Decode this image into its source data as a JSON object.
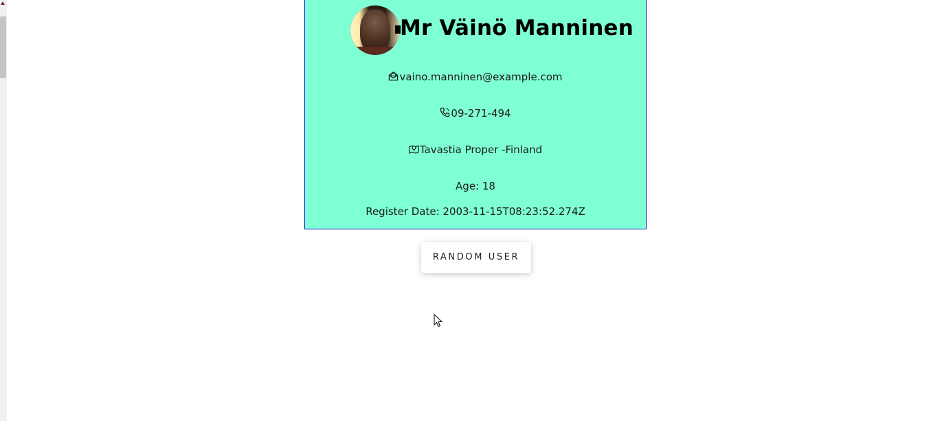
{
  "user_card": {
    "name": "Mr Väinö Manninen",
    "avatar_alt": "Portrait of Väinö Manninen",
    "email": "vaino.manninen@example.com",
    "email_icon": "envelope-icon",
    "phone": "09-271-494",
    "phone_icon": "phone-icon",
    "location": "Tavastia Proper -Finland",
    "location_icon": "map-pin-icon",
    "age_line": "Age: 18",
    "register_line": "Register Date: 2003-11-15T08:23:52.274Z"
  },
  "random_button": {
    "label": "RANDOM USER"
  },
  "colors": {
    "card_background": "#7fffd4",
    "card_border": "#1a16c9"
  }
}
